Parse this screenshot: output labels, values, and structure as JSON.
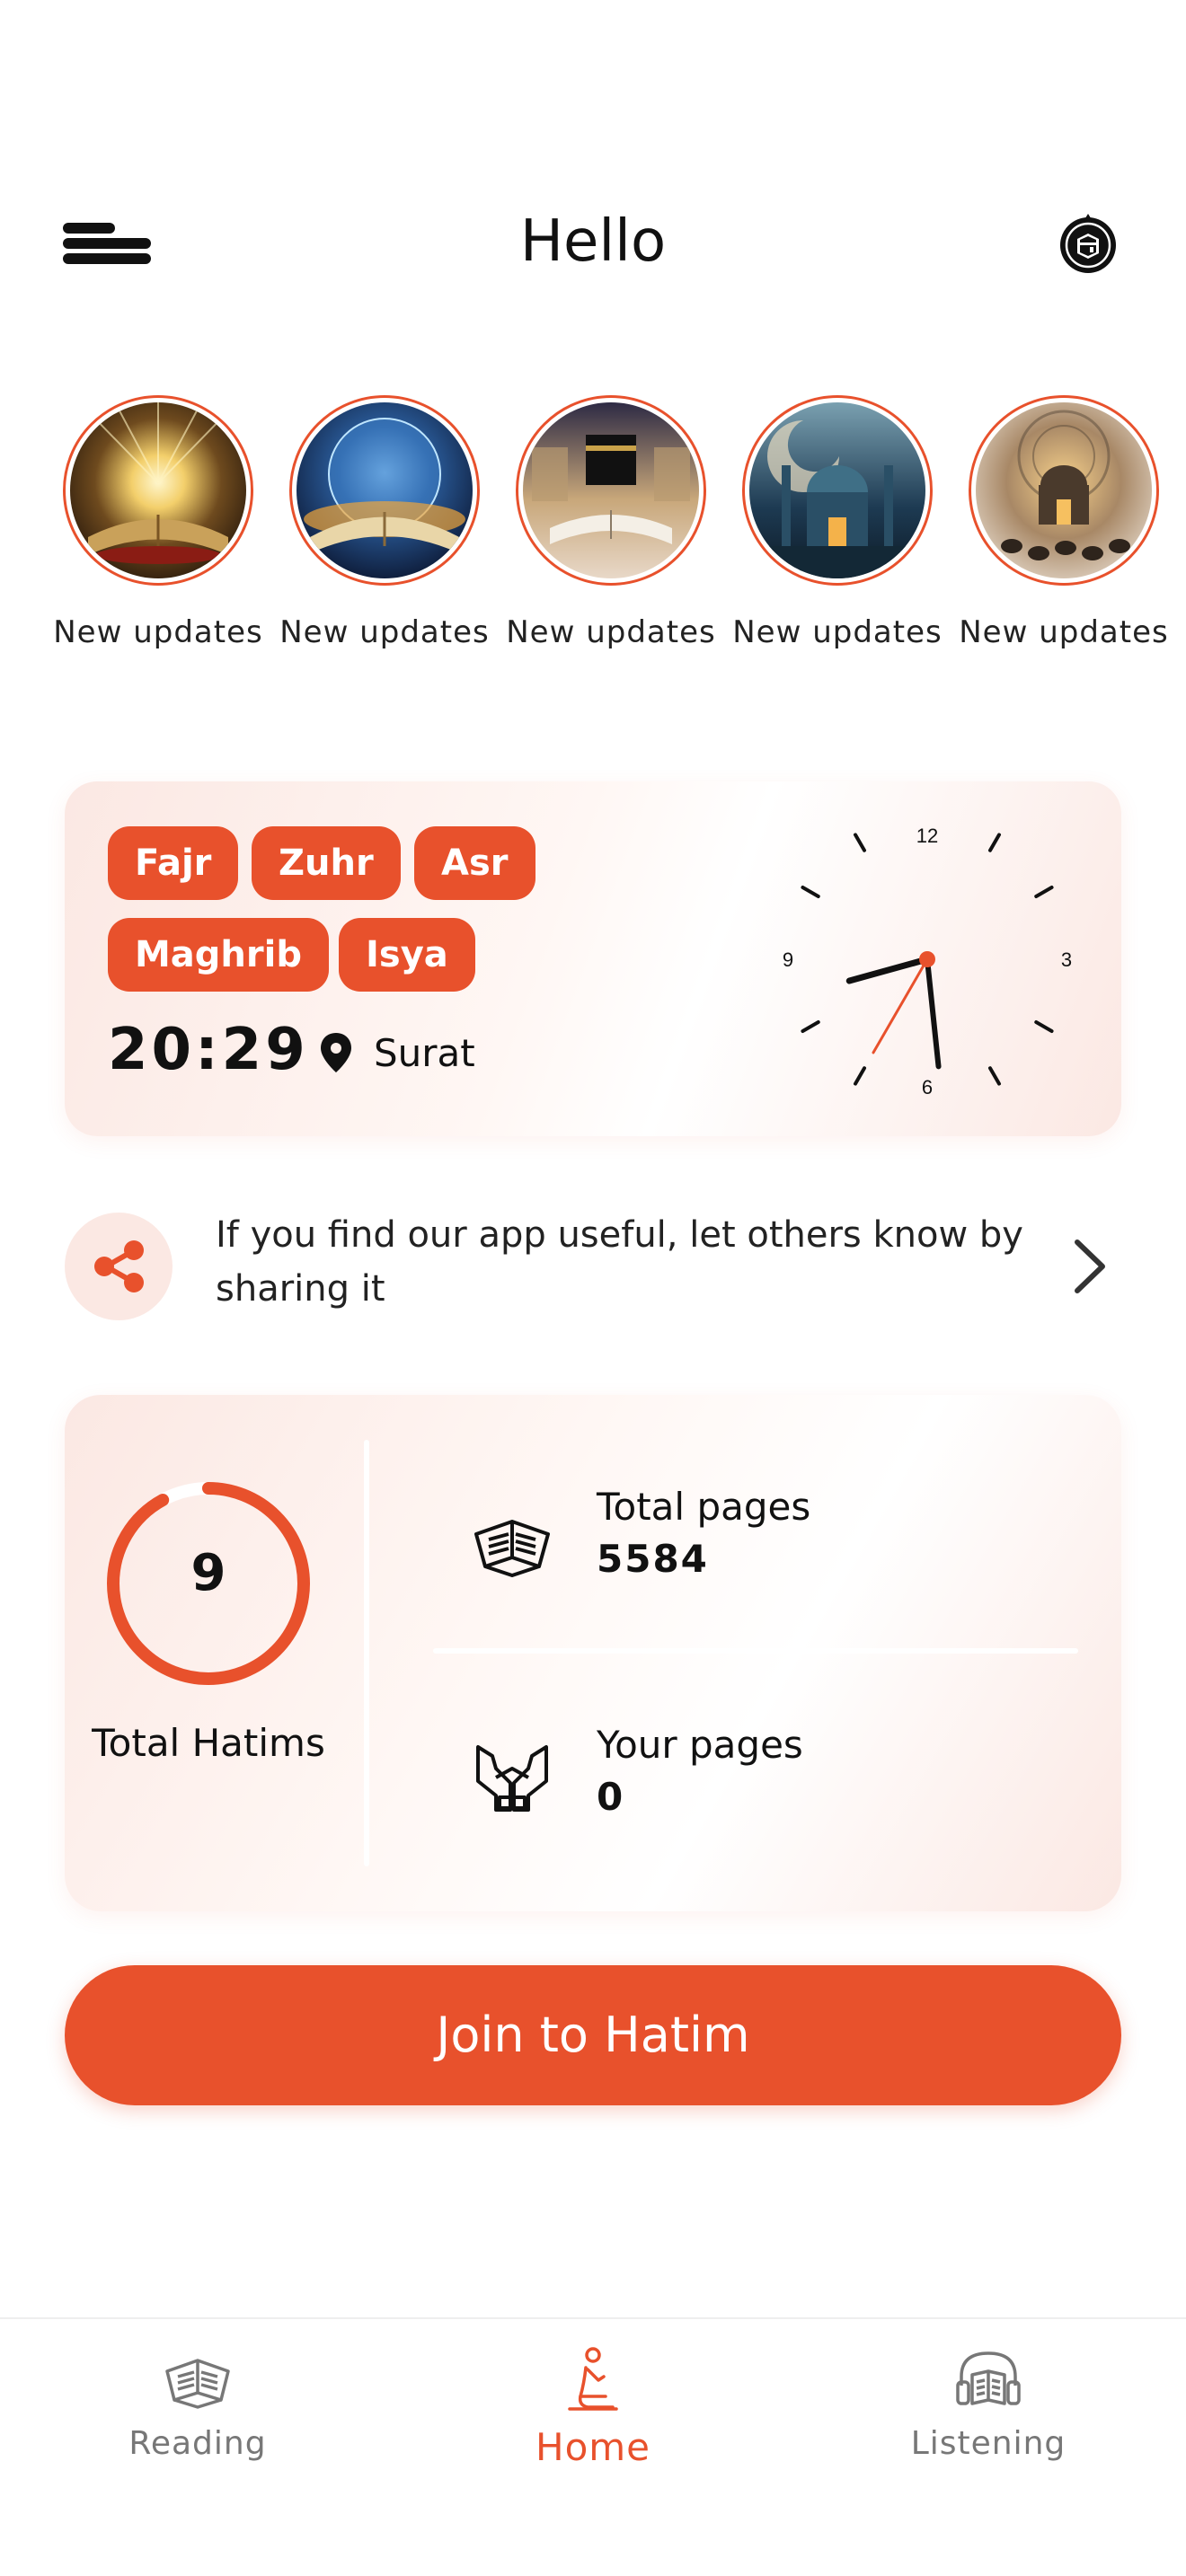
{
  "header": {
    "title": "Hello",
    "menu_icon": "menu-icon",
    "qibla_icon": "kaaba-compass-icon"
  },
  "stories": [
    {
      "label": "New updates",
      "image": "glowing-quran-book"
    },
    {
      "label": "New updates",
      "image": "open-book-under-globe"
    },
    {
      "label": "New updates",
      "image": "kaaba-with-book"
    },
    {
      "label": "New updates",
      "image": "mosque-at-night"
    },
    {
      "label": "New updates",
      "image": "mosque-with-worshippers"
    }
  ],
  "prayer": {
    "chips": [
      "Fajr",
      "Zuhr",
      "Asr",
      "Maghrib",
      "Isya"
    ],
    "time": "20:29",
    "location": "Surat",
    "clock": {
      "numerals": [
        "12",
        "3",
        "6",
        "9"
      ],
      "hour": 8,
      "minute": 29,
      "second": 35
    }
  },
  "share": {
    "text": "If you find our app useful, let others know by sharing it"
  },
  "stats": {
    "hatims_count": "9",
    "hatims_label": "Total Hatims",
    "hatims_progress": 0.92,
    "total_pages_label": "Total pages",
    "total_pages_value": "5584",
    "your_pages_label": "Your pages",
    "your_pages_value": "0"
  },
  "join_button": "Join to Hatim",
  "nav": {
    "items": [
      {
        "label": "Reading",
        "icon": "open-book-icon",
        "active": false
      },
      {
        "label": "Home",
        "icon": "praying-person-icon",
        "active": true
      },
      {
        "label": "Listening",
        "icon": "headphones-book-icon",
        "active": false
      }
    ]
  },
  "colors": {
    "accent": "#e8512c",
    "card_tint": "#fbe8e3",
    "text": "#111111",
    "muted": "#777777"
  }
}
